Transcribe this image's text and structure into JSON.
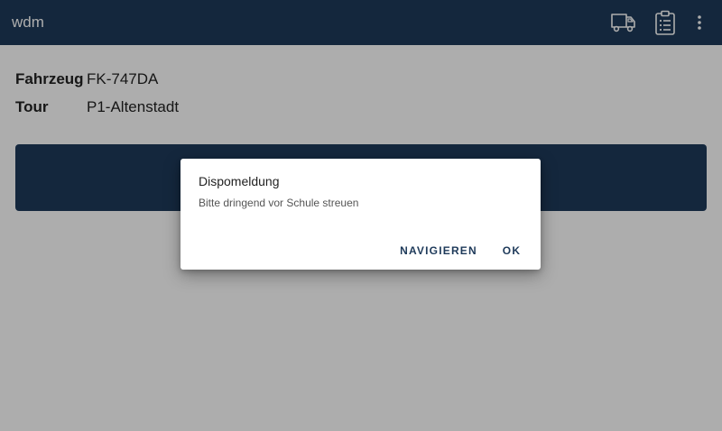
{
  "app_bar": {
    "title": "wdm",
    "icons": [
      "truck-icon",
      "clipboard-list-icon",
      "more-vertical-icon"
    ],
    "background": "#1e3a5a"
  },
  "info": {
    "vehicle_label": "Fahrzeug",
    "vehicle_value": "FK-747DA",
    "tour_label": "Tour",
    "tour_value": "P1-Altenstadt"
  },
  "colors": {
    "primary": "#1e3a5a",
    "scrim": "rgba(0,0,0,0.32)"
  },
  "dialog": {
    "title": "Dispomeldung",
    "message": "Bitte dringend vor Schule streuen",
    "navigate_label": "NAVIGIEREN",
    "ok_label": "OK"
  }
}
